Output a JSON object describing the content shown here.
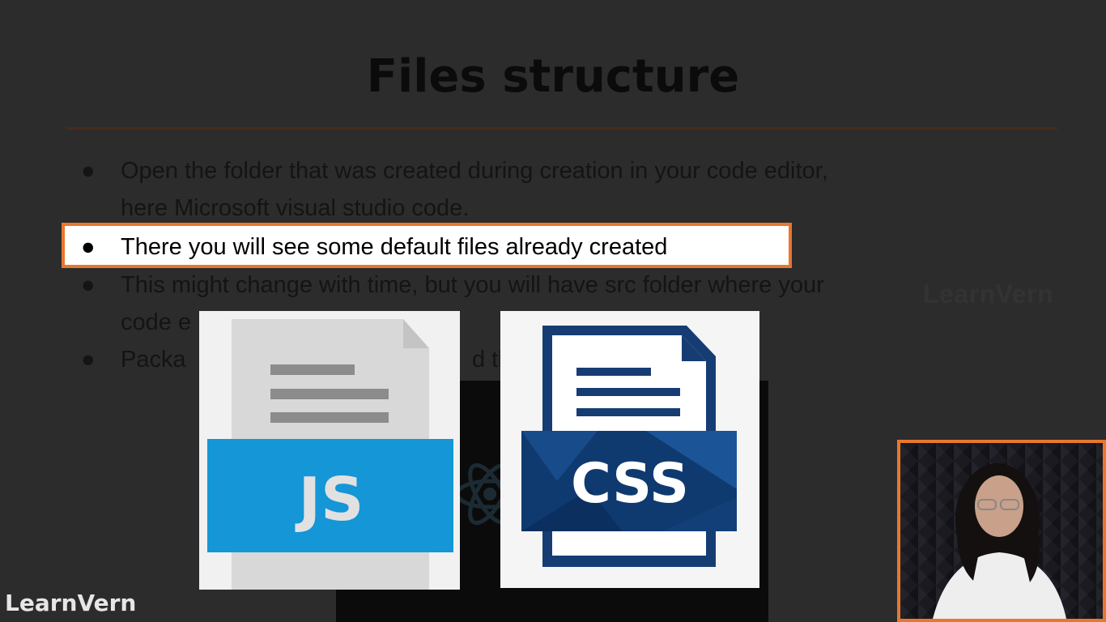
{
  "slide": {
    "title": "Files structure",
    "bullets": [
      {
        "lines": [
          "Open the folder that was created during creation in your code editor,",
          "here Microsoft visual studio code."
        ]
      },
      {
        "lines": [
          "There you will see some default files already created"
        ],
        "highlighted": true
      },
      {
        "lines": [
          "This might change with time, but you will have src folder where your",
          "code e"
        ]
      },
      {
        "lines": [
          "Packa",
          "d the"
        ]
      }
    ]
  },
  "images": {
    "js_icon": {
      "name": "js-file-icon",
      "label": "JS",
      "color": "#1496d7"
    },
    "css_icon": {
      "name": "css-file-icon",
      "label": "CSS",
      "color": "#0f3a70"
    }
  },
  "watermark": {
    "text": "LearnVern"
  },
  "brand": {
    "text": "LearnVern"
  },
  "colors": {
    "accent": "#e8772e",
    "background": "#2c2c2c"
  }
}
